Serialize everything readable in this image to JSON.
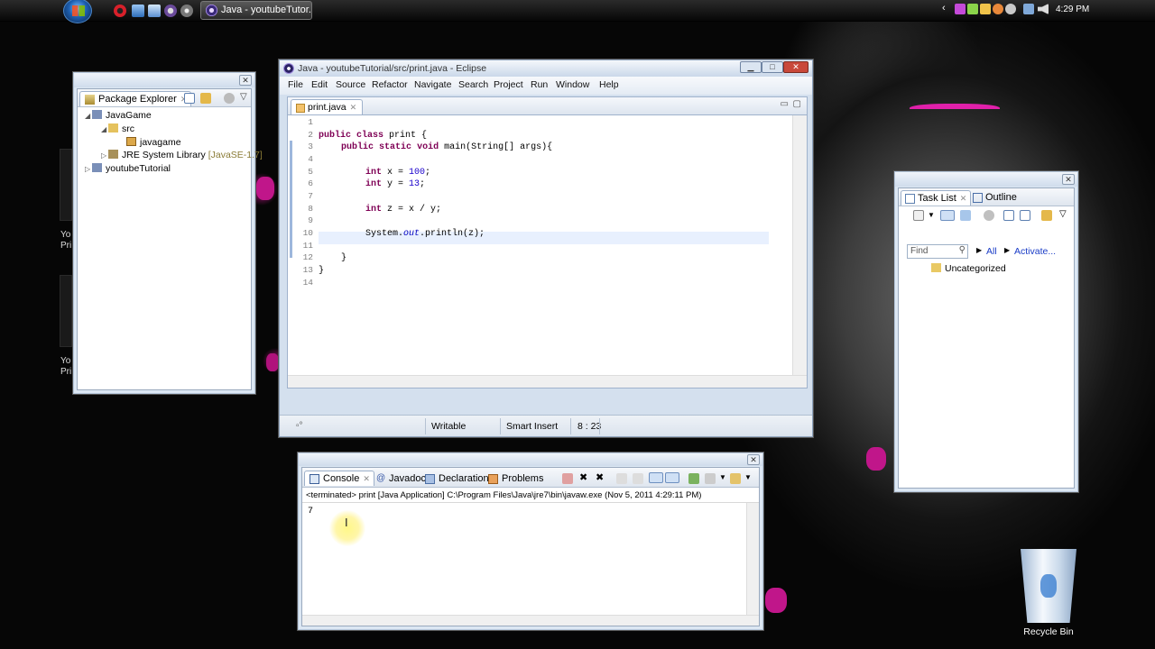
{
  "taskbar": {
    "task_label": "Java - youtubeTutor...",
    "clock": "4:29 PM"
  },
  "desktop": {
    "side_labels": [
      "Yo",
      "Pri",
      "Yo",
      "Pri"
    ],
    "recycle_bin": "Recycle Bin"
  },
  "package_explorer": {
    "tab_label": "Package Explorer",
    "tree": [
      {
        "label": "JavaGame",
        "level": 0
      },
      {
        "label": "src",
        "level": 1
      },
      {
        "label": "javagame",
        "level": 2
      },
      {
        "label": "JRE System Library",
        "suffix": "[JavaSE-1.7]",
        "level": 1
      },
      {
        "label": "youtubeTutorial",
        "level": 0
      }
    ]
  },
  "eclipse": {
    "title": "Java - youtubeTutorial/src/print.java - Eclipse",
    "menu": [
      "File",
      "Edit",
      "Source",
      "Refactor",
      "Navigate",
      "Search",
      "Project",
      "Run",
      "Window",
      "Help"
    ],
    "editor_tab": "print.java",
    "line_numbers": [
      "1",
      "2",
      "3",
      "4",
      "5",
      "6",
      "7",
      "8",
      "9",
      "10",
      "11",
      "12",
      "13",
      "14"
    ],
    "code": {
      "l2_kw1": "public",
      "l2_kw2": "class",
      "l2_rest": " print {",
      "l3_kw1": "public",
      "l3_kw2": "static",
      "l3_kw3": "void",
      "l3_rest": " main(String[] args){",
      "l5_kw": "int",
      "l5_mid": " x = ",
      "l5_num": "100",
      "l5_end": ";",
      "l6_kw": "int",
      "l6_mid": " y = ",
      "l6_num": "13",
      "l6_end": ";",
      "l8_kw": "int",
      "l8_rest": " z = x / y;",
      "l10_a": "System.",
      "l10_fld": "out",
      "l10_b": ".println(z);",
      "l12": "}",
      "l13": "}"
    },
    "status": {
      "writable": "Writable",
      "insert_mode": "Smart Insert",
      "position": "8 : 23"
    }
  },
  "task_list": {
    "tab_task": "Task List",
    "tab_outline": "Outline",
    "find_placeholder": "Find",
    "all_link": "All",
    "activate_link": "Activate...",
    "category": "Uncategorized"
  },
  "console": {
    "tabs": [
      "Console",
      "Javadoc",
      "Declaration",
      "Problems"
    ],
    "status_line": "<terminated> print [Java Application] C:\\Program Files\\Java\\jre7\\bin\\javaw.exe (Nov 5, 2011 4:29:11 PM)",
    "output": "7"
  },
  "colors": {
    "keyword": "#7f0055",
    "number": "#1a00cc",
    "field": "#0000c0",
    "link": "#1a3cc7",
    "desktop_accent": "#c0168a"
  }
}
